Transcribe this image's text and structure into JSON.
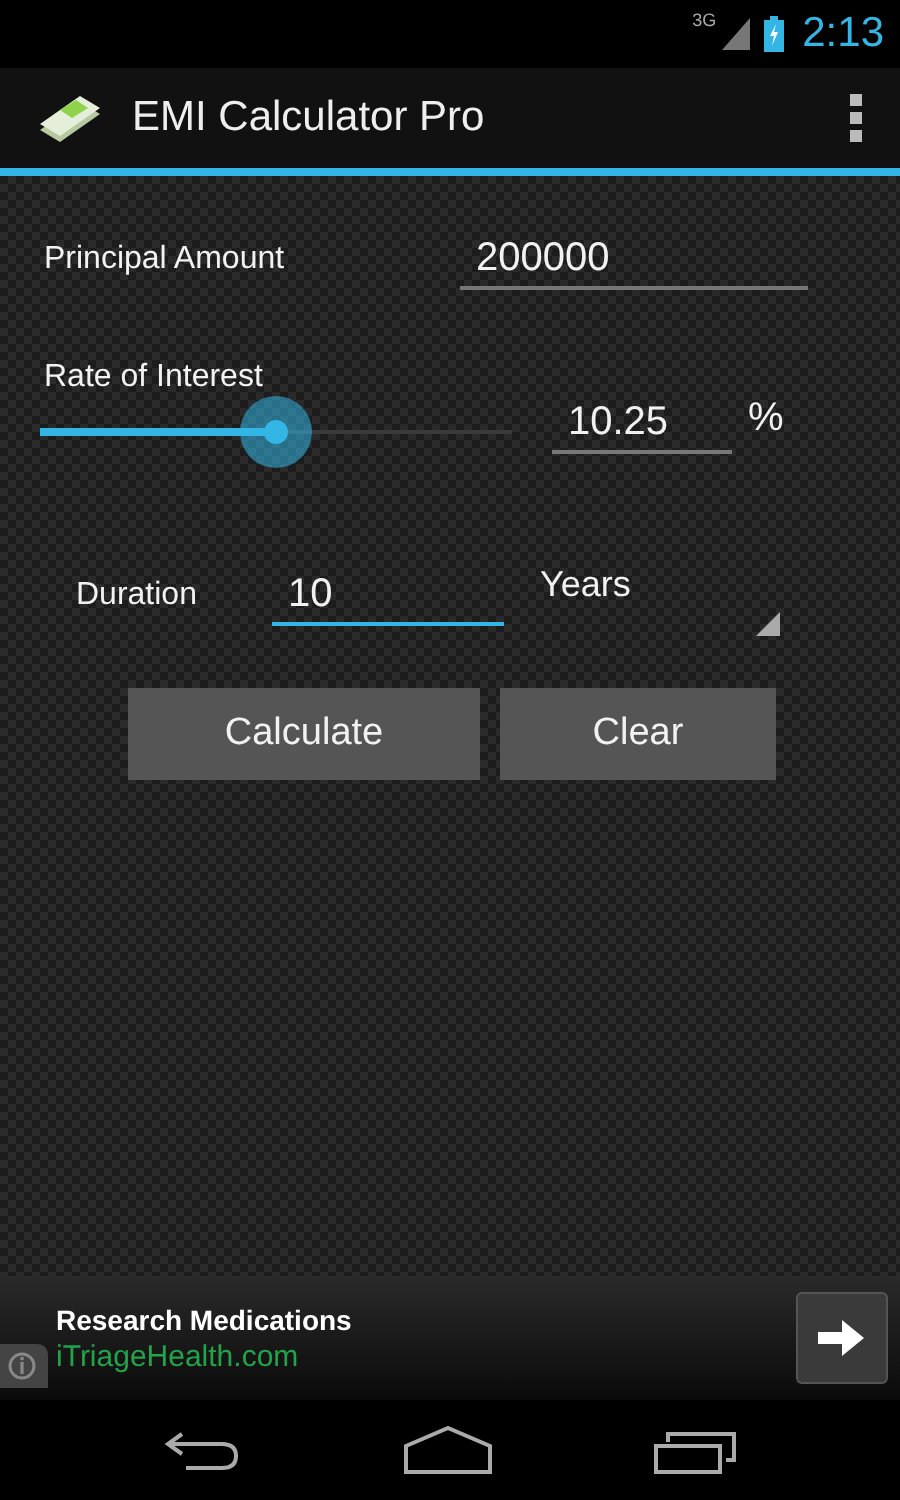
{
  "status_bar": {
    "network": "3G",
    "time": "2:13"
  },
  "action_bar": {
    "title": "EMI Calculator Pro"
  },
  "principal": {
    "label": "Principal Amount",
    "value": "200000"
  },
  "rate": {
    "label": "Rate of Interest",
    "level": 0.5,
    "value": "10.25",
    "unit": "%"
  },
  "duration": {
    "label": "Duration",
    "value": "10",
    "focused": true,
    "unit": "Years"
  },
  "buttons": [
    {
      "label": "Calculate"
    },
    {
      "label": "Clear"
    }
  ],
  "ad": {
    "headline": "Research Medications",
    "url": "iTriageHealth.com"
  }
}
